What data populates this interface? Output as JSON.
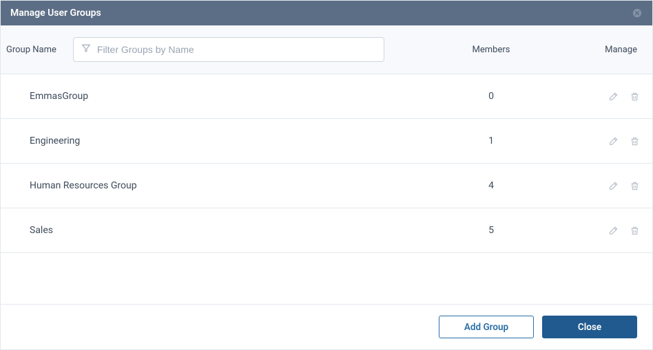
{
  "header": {
    "title": "Manage User Groups"
  },
  "columns": {
    "name": "Group Name",
    "members": "Members",
    "manage": "Manage"
  },
  "filter": {
    "placeholder": "Filter Groups by Name",
    "value": ""
  },
  "groups": [
    {
      "name": "EmmasGroup",
      "members": "0"
    },
    {
      "name": "Engineering",
      "members": "1"
    },
    {
      "name": "Human Resources Group",
      "members": "4"
    },
    {
      "name": "Sales",
      "members": "5"
    }
  ],
  "footer": {
    "add_label": "Add Group",
    "close_label": "Close"
  }
}
